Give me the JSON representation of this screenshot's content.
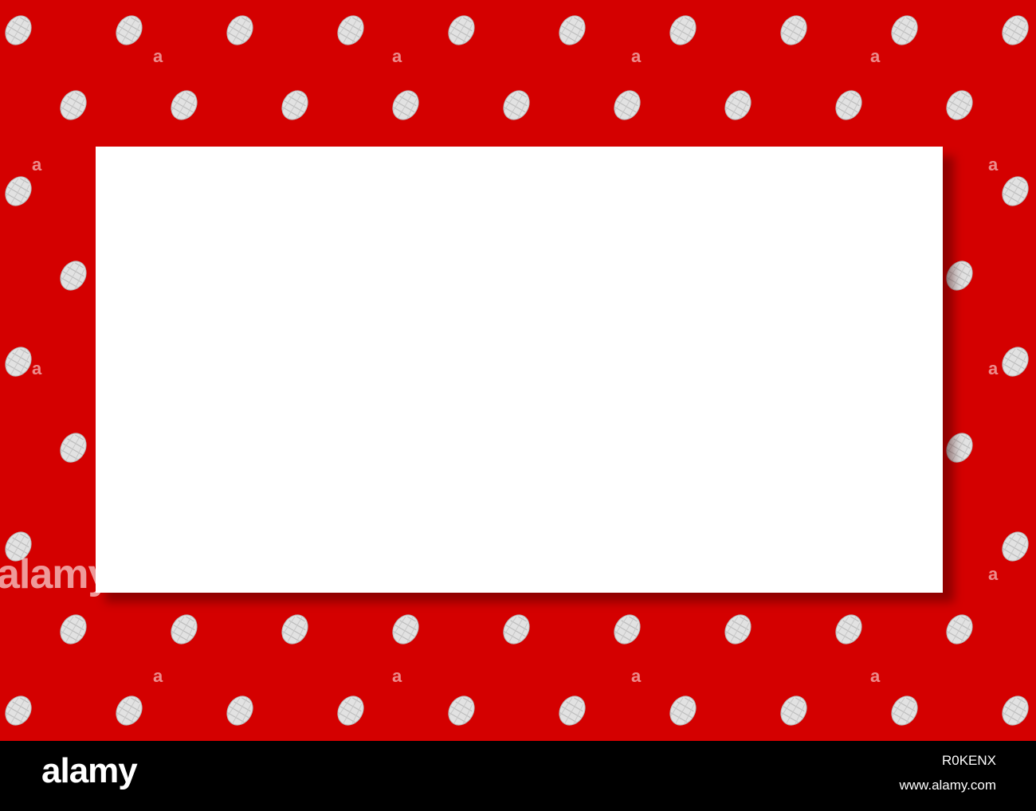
{
  "background": {
    "color": "#d40000",
    "motif": "white-pine-cone",
    "motif_color": "#e6e6e6"
  },
  "card": {
    "color": "#ffffff"
  },
  "watermark": {
    "side_text": "alamy",
    "small_mark": "a"
  },
  "footer": {
    "brand": "alamy",
    "image_id": "R0KENX",
    "url": "www.alamy.com"
  }
}
